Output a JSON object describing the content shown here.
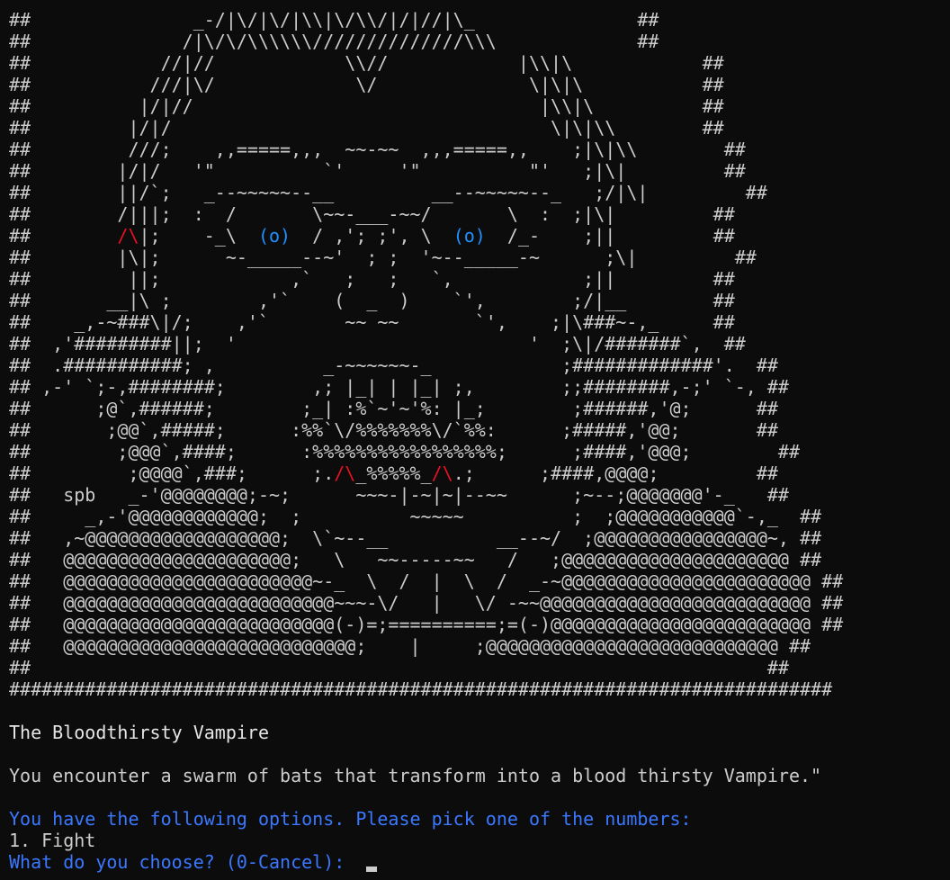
{
  "art": [
    "##               _-/|\\/|\\/|\\\\|\\/\\\\/|/|//|\\_               ##",
    "##              /|\\/\\/\\\\\\\\\\\\//////////////\\\\\\             ##",
    "##            //|//            \\\\//            |\\\\|\\            ##",
    "##           ///|\\/             \\/              \\|\\|\\           ##",
    "##          |/|//                                |\\\\|\\          ##",
    "##         |/|/                                   \\|\\|\\\\        ##",
    "##         ///;    ,,=====,,,  ~~-~~  ,,,=====,,    ;|\\|\\\\        ##",
    "##        |/|/   '\"          `'     '\"          \"'   ;|\\|         ##",
    "##        ||/`;   _--~~~~~--__         __--~~~~~--_   ;/|\\|         ##",
    "##        /|||;  :  /       \\~~-___-~~/       \\  :  ;|\\|         ##",
    "##        /\\|;    -_\\  (o)  / ,'; ;', \\  (o)  /_-    ;||         ##",
    "##        |\\|;      ~-_____--~'  ; ;  '~--_____-~      ;\\|         ##",
    "##         ||;            ,`   ;   ;   `,            ;||         ##",
    "##       __|\\ ;        ,'`    (  _  )    `',        ;/|__        ##",
    "##    _,-~###\\|/;    ,'`       ~~ ~~       `',    ;|\\###~-,_     ##",
    "##  ,'#########||;  '                           '  ;\\|/#######`,  ##",
    "##  .###########; ,          _-~~~~~~-_            ;#############'.  ##",
    "## ,-' `;-,########;        ,; |_| | |_| ;,        ;;########,-;' `-, ##",
    "##      ;@`,######;        ;_| :%`~'~'%: |_;        ;######,'@;      ##",
    "##       ;@@`,#####;      :%%`\\/%%%%%%%\\/`%%:      ;#####,'@@;       ##",
    "##        ;@@@`,####;      :%%%%%%%%%%%%%%%%%;      ;####,'@@@;        ##",
    "##         ;@@@@`,###;      ;./\\_%%%%%_/\\.;      ;####,@@@@;         ##",
    "##   spb   _-'@@@@@@@@;-~;      ~~~-|-~|~|--~~      ;~--;@@@@@@@'-_   ##",
    "##     _,-'@@@@@@@@@@@@;  ;          ~~~~~          ;  ;@@@@@@@@@@@`-,_  ##",
    "##   ,~@@@@@@@@@@@@@@@@@@;  \\`~--__          __--~/  ;@@@@@@@@@@@@@@@@~, ##",
    "##   @@@@@@@@@@@@@@@@@@@@@;   \\   ~~-----~~   /   ;@@@@@@@@@@@@@@@@@@@@@ ##",
    "##   @@@@@@@@@@@@@@@@@@@@@@@~-_  \\  /  |  \\  /  _-~@@@@@@@@@@@@@@@@@@@@@@@ ##",
    "##   @@@@@@@@@@@@@@@@@@@@@@@@@~~~-\\/   |   \\/ -~~@@@@@@@@@@@@@@@@@@@@@@@@@ ##",
    "##   @@@@@@@@@@@@@@@@@@@@@@@@@(-)=;==========;=(-)@@@@@@@@@@@@@@@@@@@@@@@@ ##",
    "##   @@@@@@@@@@@@@@@@@@@@@@@@@@@;    |     ;@@@@@@@@@@@@@@@@@@@@@@@@@@@ ##",
    "##                                                                    ##",
    "############################################################################"
  ],
  "encounter": {
    "title": "The Bloodthirsty Vampire",
    "description": "You encounter a swarm of bats that transform into a blood thirsty Vampire.\""
  },
  "menu": {
    "prompt": "You have the following options. Please pick one of the numbers:",
    "options": [
      "1. Fight"
    ],
    "input_prompt": "What do you choose? (0-Cancel):"
  },
  "colors": {
    "background": "#0c0c0c",
    "text": "#cccccc",
    "prompt": "#3b78ff",
    "eyes": "#1e90ff",
    "fangs": "#e81123"
  }
}
